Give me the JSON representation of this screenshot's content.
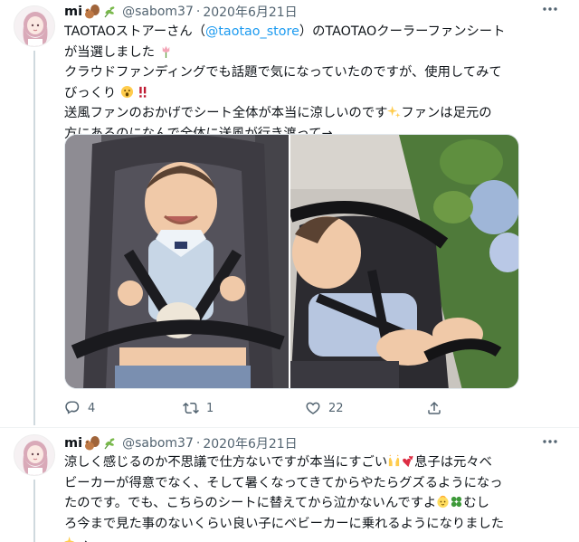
{
  "tweets": [
    {
      "name": "mi",
      "handle": "@sabom37",
      "separator": "·",
      "date": "2020年6月21日",
      "lines": [
        {
          "pre": "TAOTAOストアーさん（",
          "link": "@taotao_store",
          "post": "）のTAOTAOクーラーファンシート"
        },
        {
          "text": "が当選しました"
        },
        {
          "text": "クラウドファンディングでも話題で気になっていたのですが、使用してみて"
        },
        {
          "text": "びっくり"
        },
        {
          "pre": "送風ファンのおかげでシート全体が本当に涼しいのです",
          "post": "ファンは足元の"
        },
        {
          "text": "方にあるのになんで全体に送風が行き渡って→"
        }
      ],
      "actions": {
        "reply_count": "4",
        "retweet_count": "1",
        "like_count": "22"
      }
    },
    {
      "name": "mi",
      "handle": "@sabom37",
      "separator": "·",
      "date": "2020年6月21日",
      "lines": [
        {
          "pre": "涼しく感じるのか不思議で仕方ないですが本当にすごい",
          "post": "息子は元々ベ"
        },
        {
          "text": "ビーカーが得意でなく、そして暑くなってきてからやたらグズるようになっ"
        },
        {
          "pre": "たのです。でも、こちらのシートに替えてから泣かないんですよ",
          "post": "むし"
        },
        {
          "text": "ろ今まで見た事のないくらい良い子にベビーカーに乗れるようになりました"
        },
        {
          "text": "→"
        }
      ]
    }
  ],
  "icons": {
    "more": "more-icon",
    "reply": "reply-icon",
    "retweet": "retweet-icon",
    "like": "heart-icon",
    "share": "share-icon"
  },
  "colors": {
    "link": "#1d9bf0",
    "secondary_text": "#536471",
    "thread_line": "#cfd9de"
  }
}
